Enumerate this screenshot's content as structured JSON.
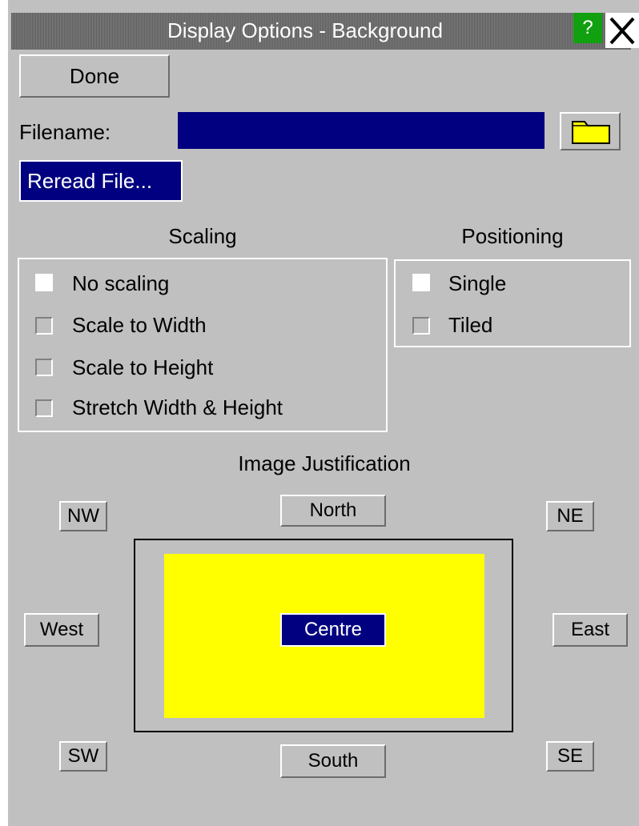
{
  "window": {
    "title": "Display Options - Background",
    "help_label": "?"
  },
  "toolbar": {
    "done_label": "Done"
  },
  "filename": {
    "label": "Filename:",
    "value": ""
  },
  "reread": {
    "label": "Reread File..."
  },
  "scaling": {
    "heading": "Scaling",
    "options": [
      {
        "label": "No scaling",
        "checked": true
      },
      {
        "label": "Scale to Width",
        "checked": false
      },
      {
        "label": "Scale to Height",
        "checked": false
      },
      {
        "label": "Stretch Width & Height",
        "checked": false
      }
    ]
  },
  "positioning": {
    "heading": "Positioning",
    "options": [
      {
        "label": "Single",
        "checked": true
      },
      {
        "label": "Tiled",
        "checked": false
      }
    ]
  },
  "justification": {
    "heading": "Image Justification",
    "nw": "NW",
    "north": "North",
    "ne": "NE",
    "west": "West",
    "centre": "Centre",
    "east": "East",
    "sw": "SW",
    "south": "South",
    "se": "SE",
    "selected": "centre"
  },
  "colors": {
    "title_bar": "#6f6f6f",
    "panel": "#c0c0c0",
    "selected": "#000080",
    "preview_fill": "#ffff00",
    "help_button": "#10a010"
  },
  "icons": {
    "folder": "folder-icon",
    "close": "close-icon"
  }
}
